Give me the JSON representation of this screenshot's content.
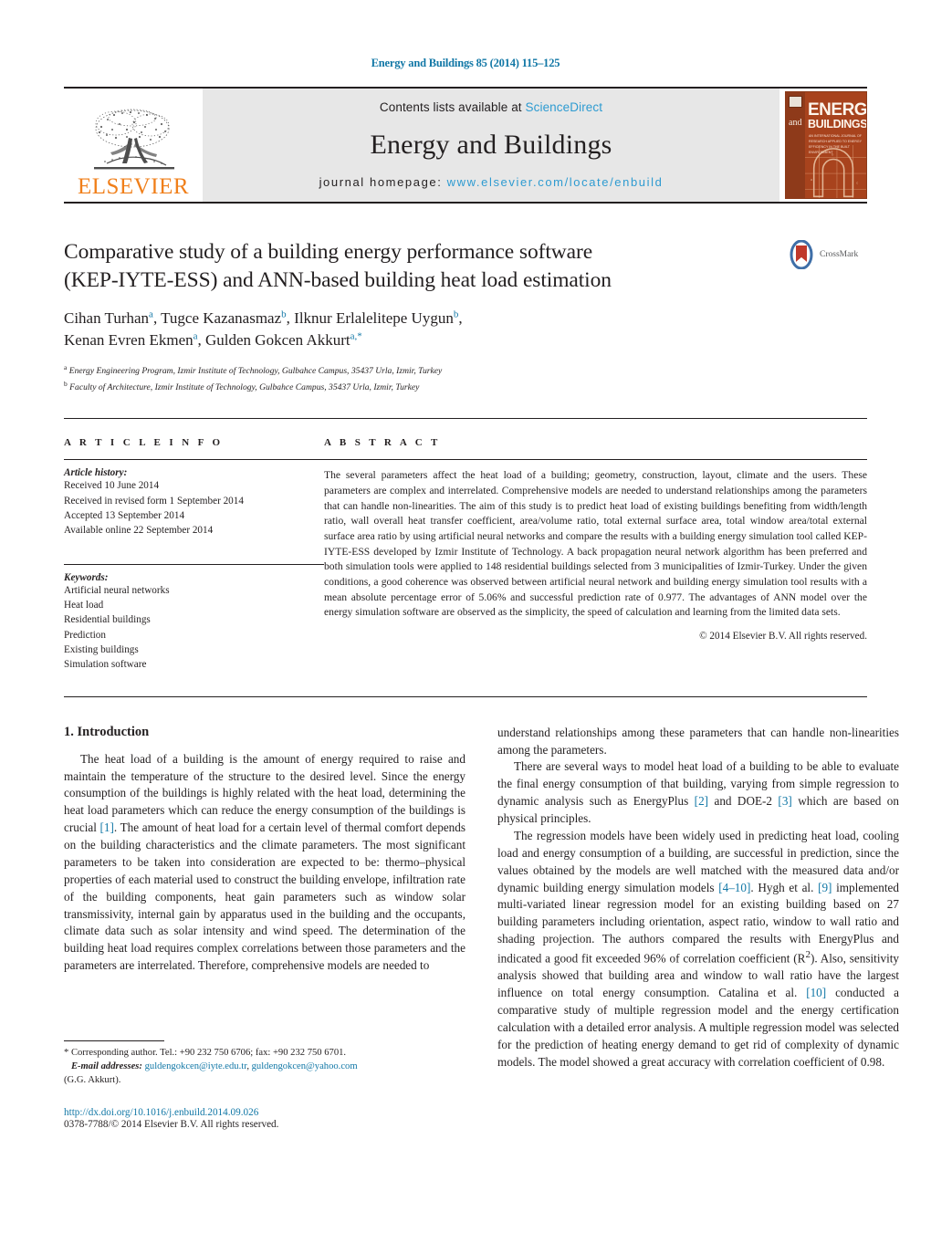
{
  "running_head": "Energy and Buildings 85 (2014) 115–125",
  "masthead": {
    "publisher": "ELSEVIER",
    "contents_prefix": "Contents lists available at ",
    "contents_link": "ScienceDirect",
    "journal_title": "Energy and Buildings",
    "homepage_label": "journal homepage:",
    "homepage_url": "www.elsevier.com/locate/enbuild",
    "cover": {
      "line_and": "and",
      "line_energy": "ENERGY",
      "line_buildings": "BUILDINGS",
      "subtitle": "AN INTERNATIONAL JOURNAL OF RESEARCH APPLIED TO ENERGY EFFICIENCY IN THE BUILT ENVIRONMENT"
    }
  },
  "article": {
    "title_line1": "Comparative study of a building energy performance software",
    "title_line2": "(KEP-IYTE-ESS) and ANN-based building heat load estimation",
    "crossmark_label": "CrossMark",
    "authors_line1_pre": "Cihan Turhan",
    "authors": "Cihan Turhan a, Tugce Kazanasmaz b, Ilknur Erlalelitepe Uygun b, Kenan Evren Ekmen a, Gulden Gokcen Akkurt a,*",
    "affiliation_a": "Energy Engineering Program, Izmir Institute of Technology, Gulbahce Campus, 35437 Urla, Izmir, Turkey",
    "affiliation_b": "Faculty of Architecture, Izmir Institute of Technology, Gulbahce Campus, 35437 Urla, Izmir, Turkey"
  },
  "info": {
    "heading": "A R T I C L E   I N F O",
    "history_label": "Article history:",
    "history": [
      "Received 10 June 2014",
      "Received in revised form 1 September 2014",
      "Accepted 13 September 2014",
      "Available online 22 September 2014"
    ],
    "keywords_label": "Keywords:",
    "keywords": [
      "Artificial neural networks",
      "Heat load",
      "Residential buildings",
      "Prediction",
      "Existing buildings",
      "Simulation software"
    ]
  },
  "abstract": {
    "heading": "A B S T R A C T",
    "text": "The several parameters affect the heat load of a building; geometry, construction, layout, climate and the users. These parameters are complex and interrelated. Comprehensive models are needed to understand relationships among the parameters that can handle non-linearities. The aim of this study is to predict heat load of existing buildings benefiting from width/length ratio, wall overall heat transfer coefficient, area/volume ratio, total external surface area, total window area/total external surface area ratio by using artificial neural networks and compare the results with a building energy simulation tool called KEP-IYTE-ESS developed by Izmir Institute of Technology. A back propagation neural network algorithm has been preferred and both simulation tools were applied to 148 residential buildings selected from 3 municipalities of Izmir-Turkey. Under the given conditions, a good coherence was observed between artificial neural network and building energy simulation tool results with a mean absolute percentage error of 5.06% and successful prediction rate of 0.977. The advantages of ANN model over the energy simulation software are observed as the simplicity, the speed of calculation and learning from the limited data sets.",
    "copyright": "© 2014 Elsevier B.V. All rights reserved."
  },
  "body": {
    "section1_title": "1.  Introduction",
    "left_para1_a": "The heat load of a building is the amount of energy required to raise and maintain the temperature of the structure to the desired level. Since the energy consumption of the buildings is highly related with the heat load, determining the heat load parameters which can reduce the energy consumption of the buildings is crucial ",
    "left_para1_ref1": "[1]",
    "left_para1_b": ". The amount of heat load for a certain level of thermal comfort depends on the building characteristics and the climate parameters. The most significant parameters to be taken into consideration are expected to be: thermo–physical properties of each material used to construct the building envelope, infiltration rate of the building components, heat gain parameters such as window solar transmissivity, internal gain by apparatus used in the building and the occupants, climate data such as solar intensity and wind speed. The determination of the building heat load requires complex correlations between those parameters and the parameters are interrelated. Therefore, comprehensive models are needed to",
    "right_para0": "understand relationships among these parameters that can handle non-linearities among the parameters.",
    "right_para1_a": "There are several ways to model heat load of a building to be able to evaluate the final energy consumption of that building, varying from simple regression to dynamic analysis such as EnergyPlus ",
    "right_para1_ref2": "[2]",
    "right_para1_b": " and DOE-2 ",
    "right_para1_ref3": "[3]",
    "right_para1_c": " which are based on physical principles.",
    "right_para2_a": "The regression models have been widely used in predicting heat load, cooling load and energy consumption of a building, are successful in prediction, since the values obtained by the models are well matched with the measured data and/or dynamic building energy simulation models ",
    "right_para2_ref4": "[4–10]",
    "right_para2_b": ". Hygh et al. ",
    "right_para2_ref9": "[9]",
    "right_para2_c": " implemented multi-variated linear regression model for an existing building based on 27 building parameters including orientation, aspect ratio, window to wall ratio and shading projection. The authors compared the results with EnergyPlus and indicated a good fit exceeded 96% of correlation coefficient (R",
    "right_para2_sup": "2",
    "right_para2_d": "). Also, sensitivity analysis showed that building area and window to wall ratio have the largest influence on total energy consumption. Catalina et al. ",
    "right_para2_ref10": "[10]",
    "right_para2_e": " conducted a comparative study of multiple regression model and the energy certification calculation with a detailed error analysis. A multiple regression model was selected for the prediction of heating energy demand to get rid of complexity of dynamic models. The model showed a great accuracy with correlation coefficient of 0.98."
  },
  "footnote": {
    "corresponding": "* Corresponding author. Tel.: +90 232 750 6706; fax: +90 232 750 6701.",
    "email_label": "E-mail addresses:",
    "email1": "guldengokcen@iyte.edu.tr",
    "email_sep": ", ",
    "email2": "guldengokcen@yahoo.com",
    "email_owner": "(G.G. Akkurt).",
    "doi": "http://dx.doi.org/10.1016/j.enbuild.2014.09.026",
    "issn": "0378-7788/© 2014 Elsevier B.V. All rights reserved."
  },
  "colors": {
    "link": "#1177a6",
    "link_light": "#2e9bd1",
    "elsevier_orange": "#f07f1a",
    "cover_bg": "#a8431d",
    "text": "#231f20"
  }
}
